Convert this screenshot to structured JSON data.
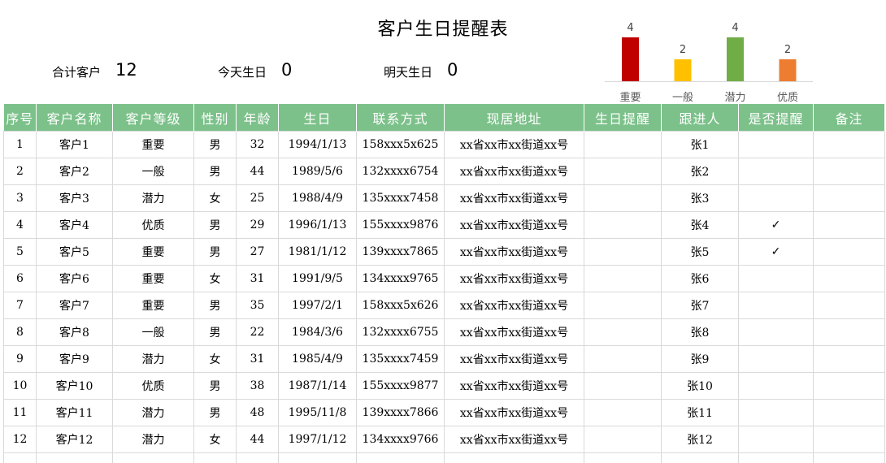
{
  "title": "客户生日提醒表",
  "stats": [
    {
      "label": "合计客户",
      "value": "12"
    },
    {
      "label": "今天生日",
      "value": "0"
    },
    {
      "label": "明天生日",
      "value": "0"
    }
  ],
  "chart_data": {
    "type": "bar",
    "title": "",
    "categories": [
      "重要",
      "一般",
      "潜力",
      "优质"
    ],
    "values": [
      4,
      2,
      4,
      2
    ],
    "colors": [
      "#c00000",
      "#ffc000",
      "#70ad47",
      "#ed7d31"
    ],
    "ylim": [
      0,
      4
    ],
    "grid": false,
    "legend": "none"
  },
  "table": {
    "header_color": "#7cc18a",
    "columns": [
      "序号",
      "客户名称",
      "客户等级",
      "性别",
      "年龄",
      "生日",
      "联系方式",
      "现居地址",
      "生日提醒",
      "跟进人",
      "是否提醒",
      "备注"
    ],
    "rows": [
      [
        "1",
        "客户1",
        "重要",
        "男",
        "32",
        "1994/1/13",
        "158xxx5x625",
        "xx省xx市xx街道xx号",
        "",
        "张1",
        "",
        ""
      ],
      [
        "2",
        "客户2",
        "一般",
        "男",
        "44",
        "1989/5/6",
        "132xxxx6754",
        "xx省xx市xx街道xx号",
        "",
        "张2",
        "",
        ""
      ],
      [
        "3",
        "客户3",
        "潜力",
        "女",
        "25",
        "1988/4/9",
        "135xxxx7458",
        "xx省xx市xx街道xx号",
        "",
        "张3",
        "",
        ""
      ],
      [
        "4",
        "客户4",
        "优质",
        "男",
        "29",
        "1996/1/13",
        "155xxxx9876",
        "xx省xx市xx街道xx号",
        "",
        "张4",
        "✓",
        ""
      ],
      [
        "5",
        "客户5",
        "重要",
        "男",
        "27",
        "1981/1/12",
        "139xxxx7865",
        "xx省xx市xx街道xx号",
        "",
        "张5",
        "✓",
        ""
      ],
      [
        "6",
        "客户6",
        "重要",
        "女",
        "31",
        "1991/9/5",
        "134xxxx9765",
        "xx省xx市xx街道xx号",
        "",
        "张6",
        "",
        ""
      ],
      [
        "7",
        "客户7",
        "重要",
        "男",
        "35",
        "1997/2/1",
        "158xxx5x626",
        "xx省xx市xx街道xx号",
        "",
        "张7",
        "",
        ""
      ],
      [
        "8",
        "客户8",
        "一般",
        "男",
        "22",
        "1984/3/6",
        "132xxxx6755",
        "xx省xx市xx街道xx号",
        "",
        "张8",
        "",
        ""
      ],
      [
        "9",
        "客户9",
        "潜力",
        "女",
        "31",
        "1985/4/9",
        "135xxxx7459",
        "xx省xx市xx街道xx号",
        "",
        "张9",
        "",
        ""
      ],
      [
        "10",
        "客户10",
        "优质",
        "男",
        "38",
        "1987/1/14",
        "155xxxx9877",
        "xx省xx市xx街道xx号",
        "",
        "张10",
        "",
        ""
      ],
      [
        "11",
        "客户11",
        "潜力",
        "男",
        "48",
        "1995/11/8",
        "139xxxx7866",
        "xx省xx市xx街道xx号",
        "",
        "张11",
        "",
        ""
      ],
      [
        "12",
        "客户12",
        "潜力",
        "女",
        "44",
        "1997/1/12",
        "134xxxx9766",
        "xx省xx市xx街道xx号",
        "",
        "张12",
        "",
        ""
      ]
    ]
  }
}
